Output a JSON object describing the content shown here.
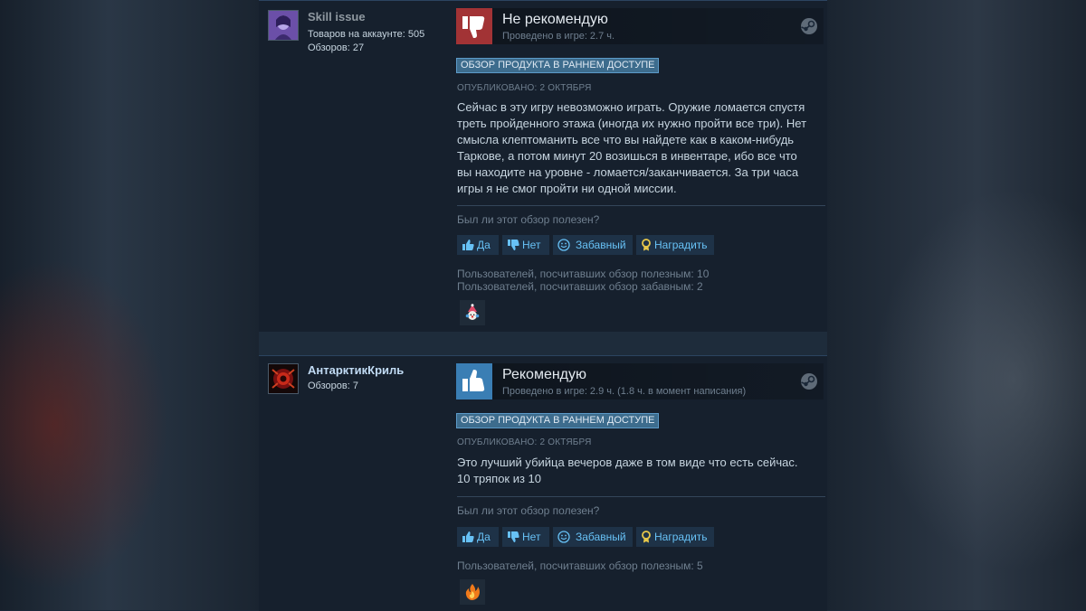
{
  "reviews": [
    {
      "author_name": "Skill issue",
      "products_text": "Товаров на аккаунте: 505",
      "reviews_text": "Обзоров: 27",
      "verdict": "Не рекомендую",
      "playtime": "Проведено в игре: 2.7 ч.",
      "badge": "ОБЗОР ПРОДУКТА В РАННЕМ ДОСТУПЕ",
      "posted": "ОПУБЛИКОВАНО: 2 ОКТЯБРЯ",
      "body_lines": [
        "Сейчас в эту игру невозможно играть. Оружие ломается спустя",
        "треть пройденного этажа (иногда их нужно пройти все три). Нет",
        "смысла клептоманить все что вы найдете как в каком-нибудь",
        "Таркове, а потом минут 20 возишься в инвентаре, ибо все что",
        "вы находите на уровне - ломается/заканчивается. За три часа",
        "игры я не смог пройти ни одной миссии."
      ],
      "helpful_question": "Был ли этот обзор полезен?",
      "buttons": {
        "yes": "Да",
        "no": "Нет",
        "funny": "Забавный",
        "award": "Наградить"
      },
      "stat_helpful": "Пользователей, посчитавших обзор полезным: 10",
      "stat_funny": "Пользователей, посчитавших обзор забавным: 2",
      "colors": {
        "thumb_bg": "#a23335"
      },
      "icons": {
        "thumb": "thumbs-down-icon",
        "award": "clown-award-icon"
      }
    },
    {
      "author_name": "АнтарктикКриль",
      "reviews_text": "Обзоров: 7",
      "verdict": "Рекомендую",
      "playtime": "Проведено в игре: 2.9 ч. (1.8 ч. в момент написания)",
      "badge": "ОБЗОР ПРОДУКТА В РАННЕМ ДОСТУПЕ",
      "posted": "ОПУБЛИКОВАНО: 2 ОКТЯБРЯ",
      "body_lines": [
        "Это лучший убийца вечеров даже в том виде что есть сейчас.",
        "10 тряпок из 10"
      ],
      "helpful_question": "Был ли этот обзор полезен?",
      "buttons": {
        "yes": "Да",
        "no": "Нет",
        "funny": "Забавный",
        "award": "Наградить"
      },
      "stat_helpful": "Пользователей, посчитавших обзор полезным: 5",
      "colors": {
        "thumb_bg": "#3a7eb4"
      },
      "icons": {
        "thumb": "thumbs-up-icon",
        "award": "fire-award-icon"
      }
    }
  ]
}
